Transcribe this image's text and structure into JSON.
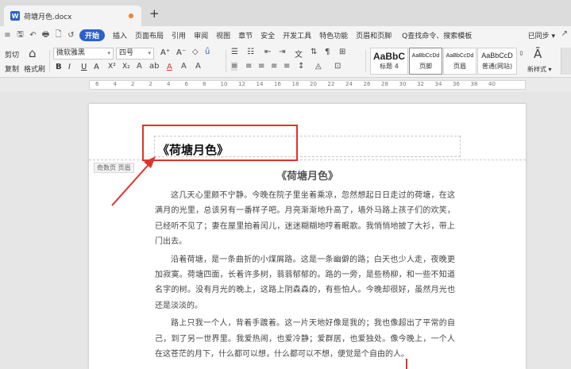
{
  "tab": {
    "title": "荷塘月色.docx",
    "doc_badge": "W",
    "add": "+"
  },
  "quick_access": [
    "≡",
    "🖫",
    "↶",
    "🖶",
    "🗋",
    "↺"
  ],
  "menu": {
    "items": [
      "开始",
      "插入",
      "页面布局",
      "引用",
      "审阅",
      "视图",
      "章节",
      "安全",
      "开发工具",
      "特色功能",
      "页眉和页脚"
    ],
    "active_index": 0,
    "search": "Q查找命令、搜索模板",
    "sync": "已同步 ▾",
    "share": "↗"
  },
  "ribbon": {
    "cut": "剪切",
    "copy": "复制",
    "format_painter": "格式刷",
    "font_name": "微软雅黑",
    "font_size": "四号",
    "bold": "B",
    "italic": "I",
    "underline": "U",
    "font_grow": "A⁺",
    "font_shrink": "A⁻",
    "superscript": "X²",
    "subscript": "X₂",
    "font_color": "A",
    "styles": [
      {
        "sample": "AaBbC",
        "name": "标题 4"
      },
      {
        "sample": "AaBbCcDd",
        "name": "页脚"
      },
      {
        "sample": "AaBbCcDd",
        "name": "页眉"
      },
      {
        "sample": "AaBbCcD",
        "name": "普通(网站)"
      }
    ],
    "new_style": "新样式 ▾"
  },
  "ruler": {
    "numbers": [
      "6",
      "4",
      "2",
      "2",
      "4",
      "6",
      "8",
      "10",
      "12",
      "14",
      "16",
      "18",
      "20",
      "22",
      "24",
      "26",
      "28",
      "30",
      "32",
      "34",
      "36",
      "38",
      "40"
    ]
  },
  "page": {
    "header_text": "《荷塘月色》",
    "header_tag": "奇数页 页眉",
    "title": "《荷塘月色》",
    "paragraphs": [
      "这几天心里颇不宁静。今晚在院子里坐着乘凉，忽然想起日日走过的荷塘，在这满月的光里，总该另有一番样子吧。月亮渐渐地升高了，墙外马路上孩子们的欢笑，已经听不见了；妻在屋里拍着闰儿，迷迷糊糊地哼着眠歌。我悄悄地披了大衫，带上门出去。",
      "沿着荷塘，是一条曲折的小煤屑路。这是一条幽僻的路；白天也少人走，夜晚更加寂寞。荷塘四面，长着许多树，蓊蓊郁郁的。路的一旁，是些杨柳，和一些不知道名字的树。没有月光的晚上，这路上阴森森的，有些怕人。今晚却很好，虽然月光也还是淡淡的。",
      "路上只我一个人，背着手踱着。这一片天地好像是我的；我也像超出了平常的自己，到了另一世界里。我爱热闹，也爱冷静；爱群居，也爱独处。像今晚上，一个人在这苍茫的月下，什么都可以想，什么都可以不想，便觉是个自由的人。"
    ]
  },
  "colors": {
    "accent": "#2b62c9",
    "annotation": "#e0322b",
    "tab_dot": "#f5811f"
  }
}
